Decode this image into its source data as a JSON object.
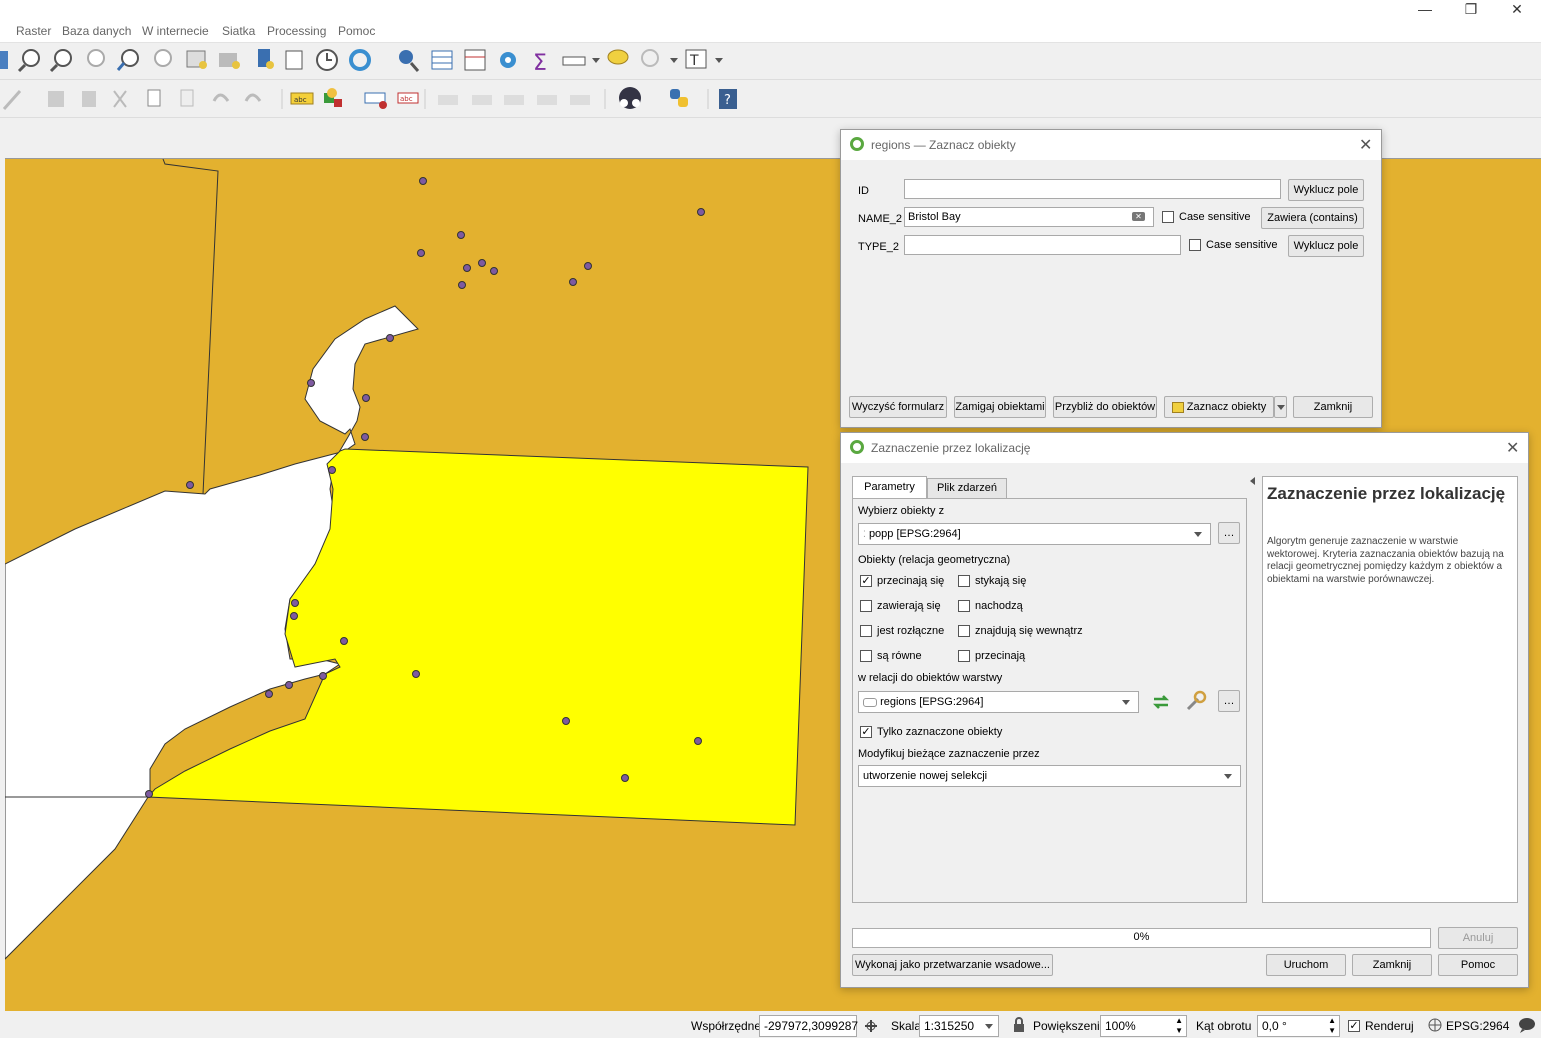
{
  "menu": [
    "Raster",
    "Baza danych",
    "W internecie",
    "Siatka",
    "Processing",
    "Pomoc"
  ],
  "window_controls": {
    "minimize": "—",
    "maximize": "❐",
    "close": "✕"
  },
  "select_dialog": {
    "title": "regions — Zaznacz obiekty",
    "fields": [
      {
        "label": "ID",
        "value": "",
        "button": "Wyklucz pole"
      },
      {
        "label": "NAME_2",
        "value": "Bristol Bay",
        "case_sensitive": "Case sensitive",
        "button": "Zawiera (contains)"
      },
      {
        "label": "TYPE_2",
        "value": "",
        "case_sensitive": "Case sensitive",
        "button": "Wyklucz pole"
      }
    ],
    "buttons": {
      "clear": "Wyczyść formularz",
      "flash": "Zamigaj obiektami",
      "zoom": "Przybliż do obiektów",
      "select": "Zaznacz obiekty",
      "close": "Zamknij"
    }
  },
  "location_dialog": {
    "title": "Zaznaczenie przez lokalizację",
    "tabs": [
      "Parametry",
      "Plik zdarzeń"
    ],
    "select_from_label": "Wybierz obiekty z",
    "select_from_value": "popp [EPSG:2964]",
    "relation_label": "Obiekty (relacja geometryczna)",
    "predicates": [
      {
        "label": "przecinają się",
        "checked": true
      },
      {
        "label": "stykają się",
        "checked": false
      },
      {
        "label": "zawierają się",
        "checked": false
      },
      {
        "label": "nachodzą",
        "checked": false
      },
      {
        "label": "jest rozłączne",
        "checked": false
      },
      {
        "label": "znajdują się wewnątrz",
        "checked": false
      },
      {
        "label": "są równe",
        "checked": false
      },
      {
        "label": "przecinają",
        "checked": false
      }
    ],
    "compare_label": "w relacji do obiektów warstwy",
    "compare_value": "regions [EPSG:2964]",
    "only_selected": "Tylko zaznaczone obiekty",
    "modify_label": "Modyfikuj bieżące zaznaczenie przez",
    "modify_value": "utworzenie nowej selekcji",
    "help_title": "Zaznaczenie przez lokalizację",
    "help_text": "Algorytm generuje zaznaczenie w warstwie wektorowej. Kryteria zaznaczania obiektów bazują na relacji geometrycznej pomiędzy każdym z obiektów a obiektami na warstwie porównawczej.",
    "progress": "0%",
    "buttons": {
      "cancel": "Anuluj",
      "batch": "Wykonaj jako przetwarzanie wsadowe...",
      "run": "Uruchom",
      "close": "Zamknij",
      "help": "Pomoc"
    }
  },
  "status": {
    "coord_label": "Współrzędne",
    "coord_value": "-297972,3099287",
    "scale_label": "Skala",
    "scale_value": "1:315250",
    "magnifier_label": "Powiększenie",
    "magnifier_value": "100%",
    "rotation_label": "Kąt obrotu",
    "rotation_value": "0,0 °",
    "render_label": "Renderuj",
    "crs": "EPSG:2964"
  },
  "colors": {
    "land": "#e3b12f",
    "selected": "#ffff00",
    "points": "#7e5aa0",
    "accent": "#5aa840"
  }
}
